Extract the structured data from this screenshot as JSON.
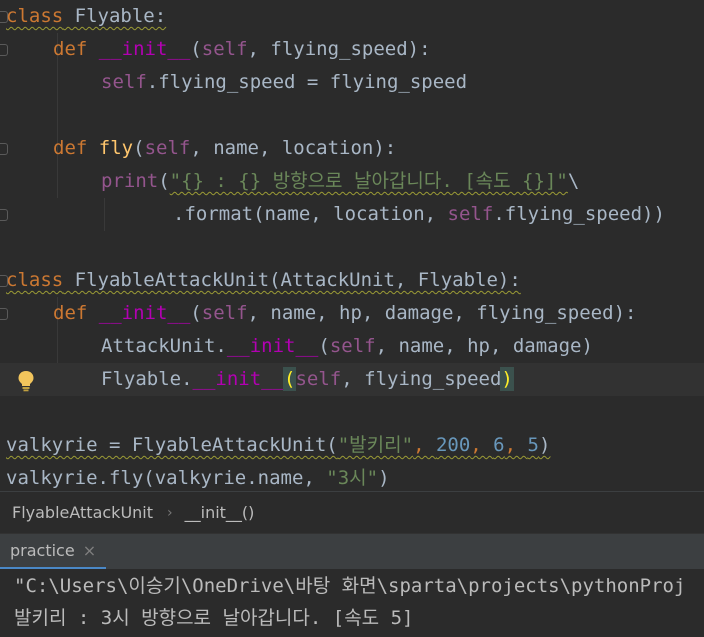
{
  "editor": {
    "lines": {
      "l1_kw": "class",
      "l1_name": " Flyable:",
      "l2_kw": "def",
      "l2_fn": "__init__",
      "l2_open": "(",
      "l2_self": "self",
      "l2_rest": ", flying_speed):",
      "l3_self": "self",
      "l3_rest": ".flying_speed = flying_speed",
      "l5_kw": "def",
      "l5_fn": "fly",
      "l5_open": "(",
      "l5_self": "self",
      "l5_rest": ", name, location):",
      "l6_fn": "print",
      "l6_open": "(",
      "l6_str": "\"{} : {} 방향으로 날아갑니다. [속도 {}]\"",
      "l6_rest": "\\",
      "l7_rest1": ".format(name, location, ",
      "l7_self": "self",
      "l7_rest2": ".flying_speed))",
      "l9_kw": "class",
      "l9_name": " FlyableAttackUnit(AttackUnit, Flyable):",
      "l10_kw": "def",
      "l10_fn": "__init__",
      "l10_open": "(",
      "l10_self": "self",
      "l10_rest": ", name, hp, damage, flying_speed):",
      "l11_a": "AttackUnit.",
      "l11_fn": "__init__",
      "l11_open": "(",
      "l11_self": "self",
      "l11_rest": ", name, hp, damage)",
      "l12_a": "Flyable.",
      "l12_fn": "__init__",
      "l12_open": "(",
      "l12_self": "self",
      "l12_rest": ", flying_speed",
      "l12_close": ")",
      "l14_a": "valkyrie = FlyableAttackUnit(",
      "l14_str": "\"발키리\"",
      "l14_c1": ", ",
      "l14_n1": "200",
      "l14_c2": ", ",
      "l14_n2": "6",
      "l14_c3": ", ",
      "l14_n3": "5",
      "l14_close": ")",
      "l15_a": "valkyrie.fly(valkyrie.name, ",
      "l15_str": "\"3시\"",
      "l15_close": ")"
    }
  },
  "breadcrumb": {
    "item1": "FlyableAttackUnit",
    "separator": "›",
    "item2": "__init__()"
  },
  "run_panel": {
    "tab_label": "practice",
    "close_glyph": "×"
  },
  "console": {
    "line1": "\"C:\\Users\\이승기\\OneDrive\\바탕 화면\\sparta\\projects\\pythonProj",
    "line2": "발키리 : 3시 방향으로 날아갑니다. [속도 5]"
  },
  "icons": {
    "intention_bulb": "lightbulb-icon",
    "fold_marker": "fold-marker-icon"
  },
  "colors": {
    "keyword": "#cc7832",
    "self": "#94558d",
    "string": "#6a8759",
    "number": "#6897bb",
    "function": "#ffc66d",
    "background": "#2b2b2b"
  }
}
